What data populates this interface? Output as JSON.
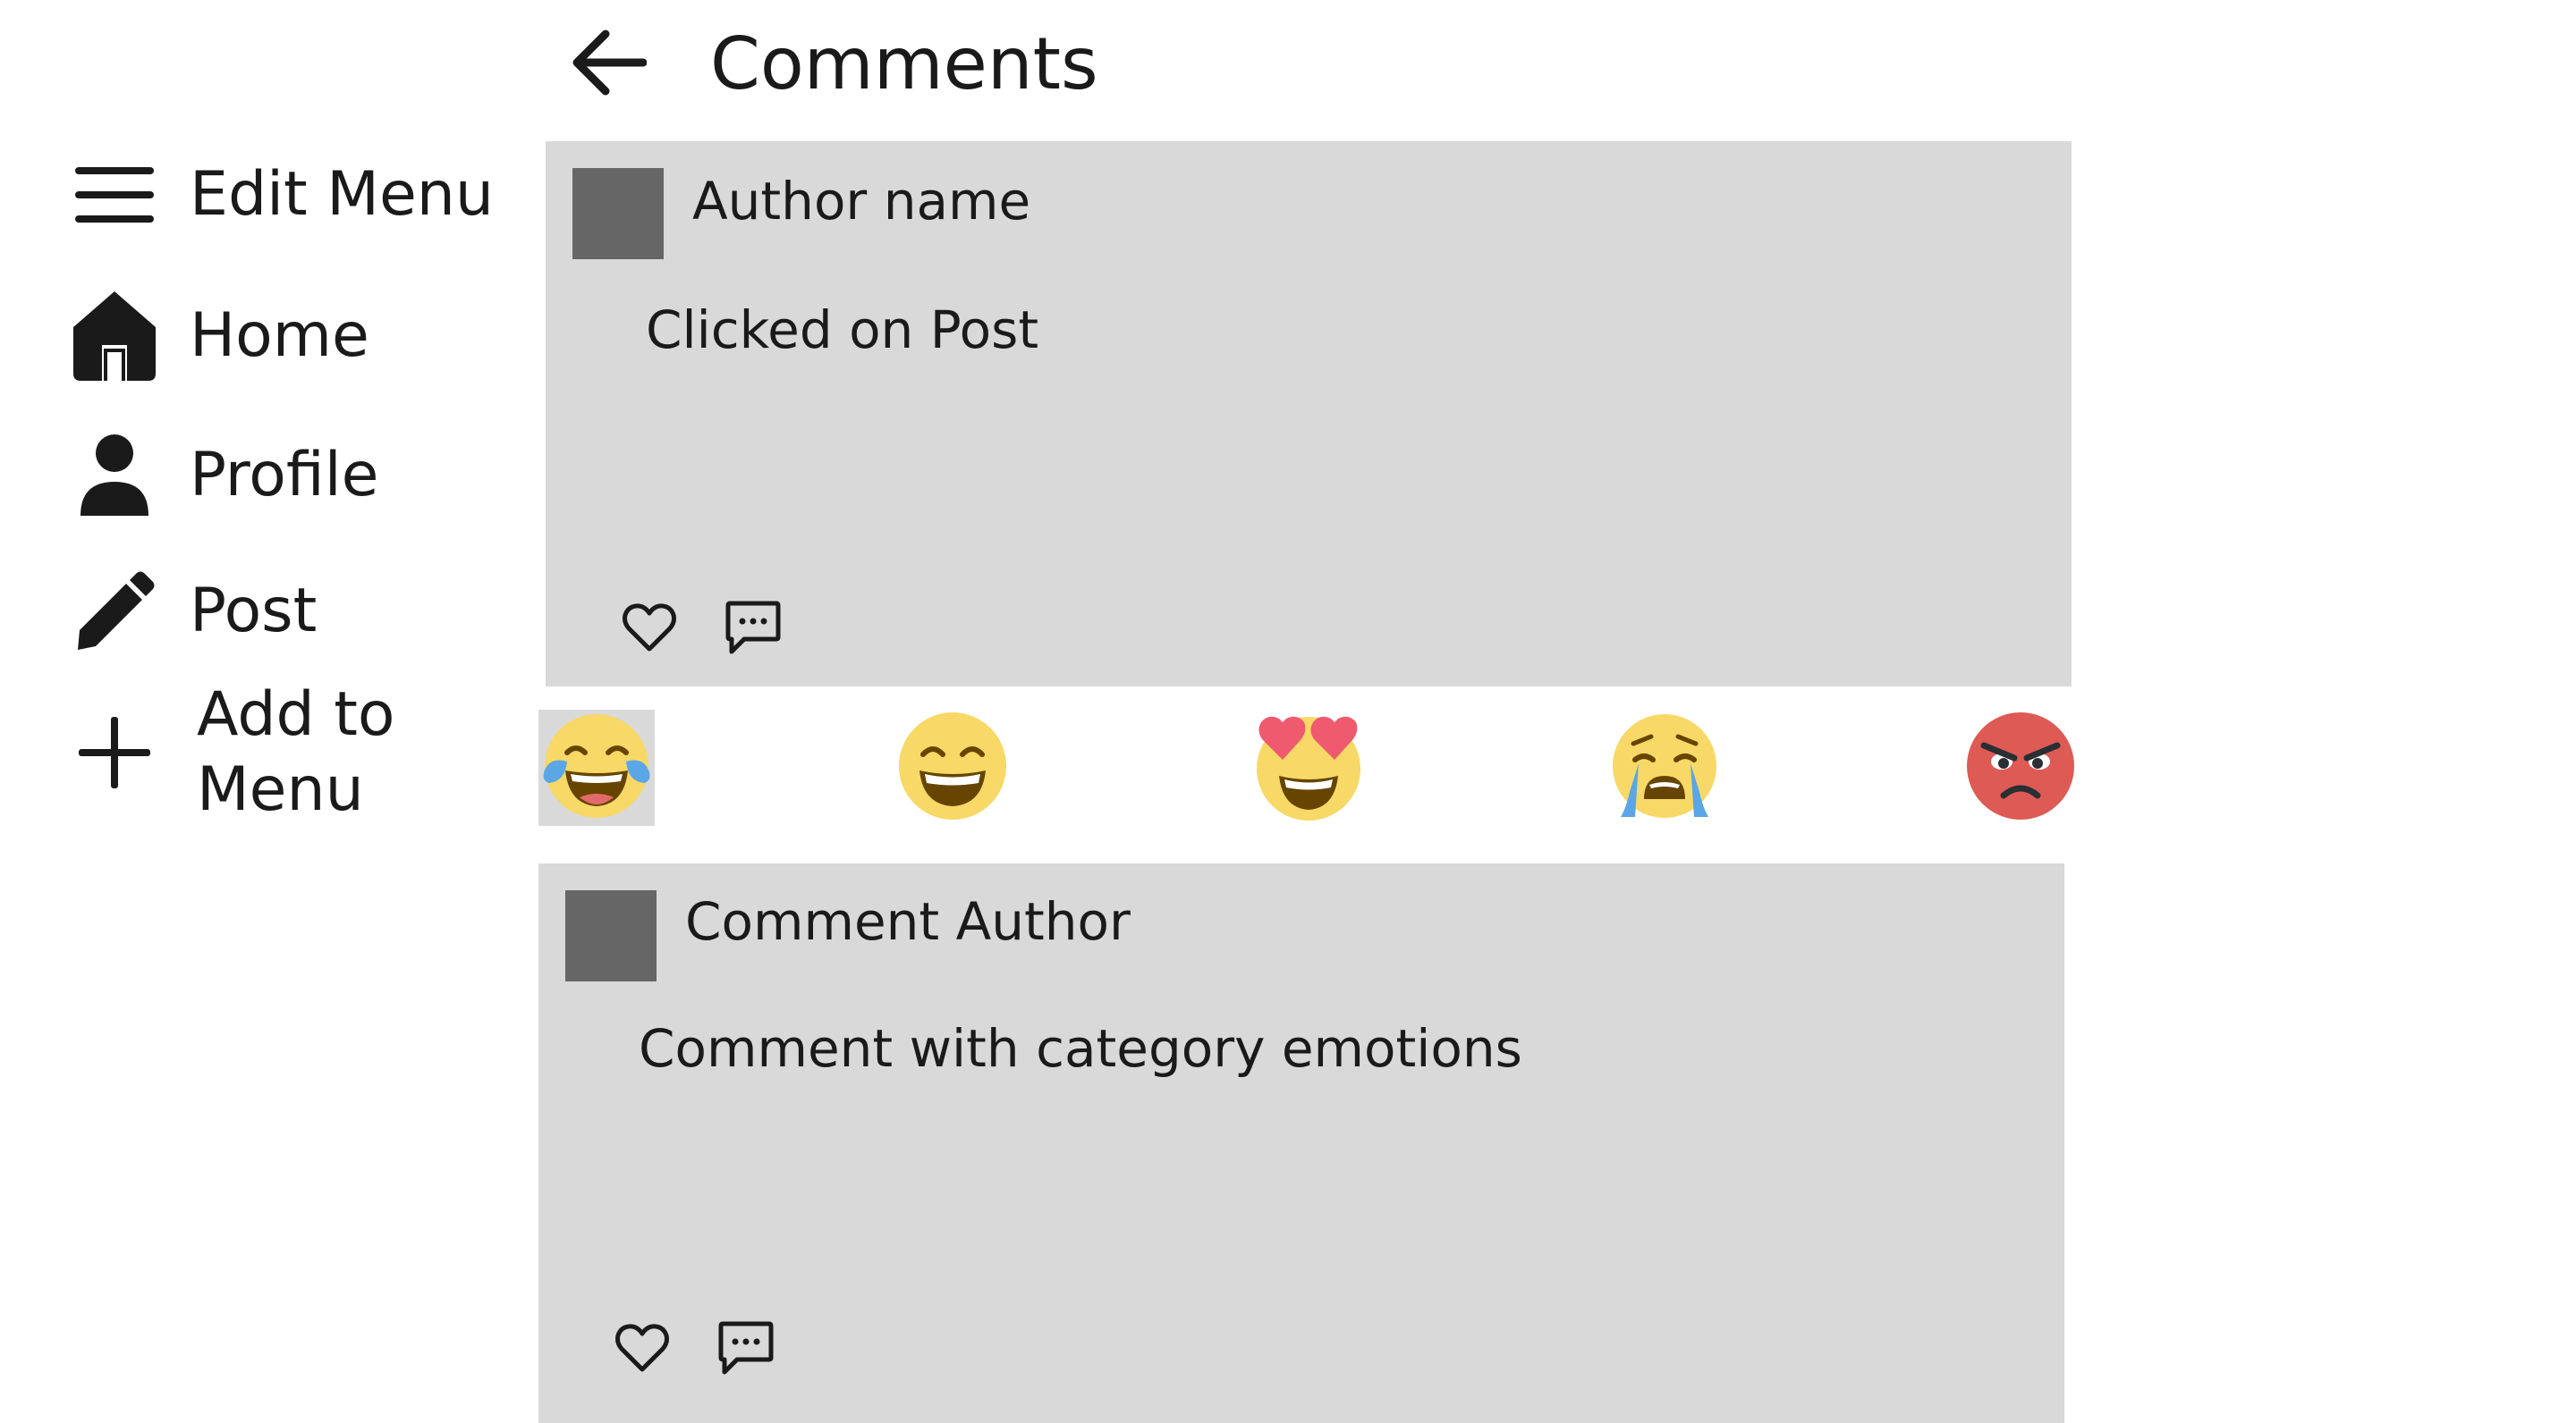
{
  "header": {
    "title": "Comments",
    "back_icon": "arrow-left-icon"
  },
  "sidebar": {
    "items": [
      {
        "label": "Edit Menu",
        "icon": "hamburger-menu-icon"
      },
      {
        "label": "Home",
        "icon": "home-icon"
      },
      {
        "label": "Profile",
        "icon": "person-icon"
      },
      {
        "label": "Post",
        "icon": "pencil-icon"
      },
      {
        "label": "Add to Menu",
        "icon": "plus-icon"
      }
    ]
  },
  "post": {
    "author": "Author name",
    "body": "Clicked on Post",
    "actions": [
      "heart-icon",
      "comment-icon"
    ]
  },
  "reactions": {
    "items": [
      {
        "name": "tears-of-joy",
        "icon": "laughing-crying-emoji-icon",
        "selected": true
      },
      {
        "name": "grinning",
        "icon": "grinning-emoji-icon",
        "selected": false
      },
      {
        "name": "heart-eyes",
        "icon": "heart-eyes-emoji-icon",
        "selected": false
      },
      {
        "name": "crying",
        "icon": "crying-emoji-icon",
        "selected": false
      },
      {
        "name": "angry",
        "icon": "angry-emoji-icon",
        "selected": false
      }
    ]
  },
  "comment": {
    "author": "Comment Author",
    "body": "Comment with category emotions",
    "actions": [
      "heart-icon",
      "comment-icon"
    ]
  },
  "colors": {
    "card_background": "#d9d9d9",
    "avatar": "#666666",
    "text": "#1a1a1a",
    "emoji_yellow": "#f8d866",
    "emoji_red": "#de5a55",
    "heart_red": "#ef5a6f",
    "tear_blue": "#5aa6e6"
  }
}
